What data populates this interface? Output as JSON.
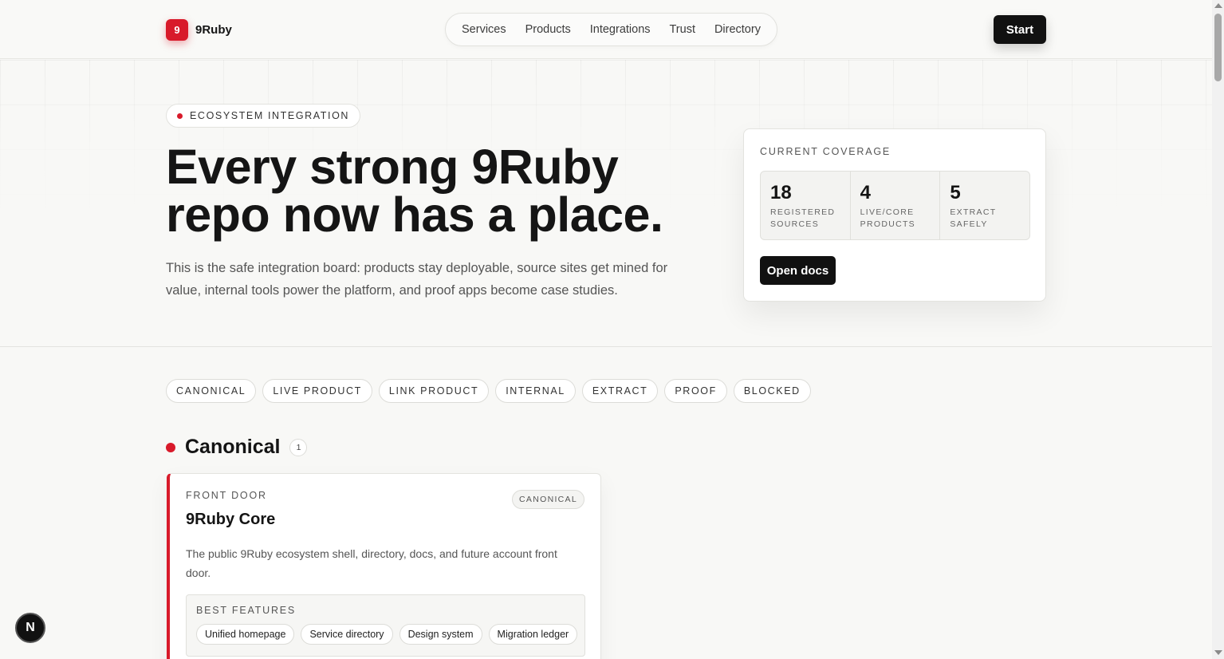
{
  "header": {
    "brand_mark": "9",
    "brand_name": "9Ruby",
    "nav": [
      "Services",
      "Products",
      "Integrations",
      "Trust",
      "Directory"
    ],
    "start_label": "Start"
  },
  "hero": {
    "eyebrow": "ECOSYSTEM INTEGRATION",
    "headline_line1": "Every strong 9Ruby",
    "headline_line2": "repo now has a place.",
    "lede_line1": "This is the safe integration board: products stay deployable, source sites get mined for",
    "lede_line2": "value, internal tools power the platform, and proof apps become case studies."
  },
  "coverage": {
    "title": "CURRENT COVERAGE",
    "stats": [
      {
        "value": "18",
        "label_line1": "REGISTERED",
        "label_line2": "SOURCES"
      },
      {
        "value": "4",
        "label_line1": "LIVE/CORE",
        "label_line2": "PRODUCTS"
      },
      {
        "value": "5",
        "label_line1": "EXTRACT",
        "label_line2": "SAFELY"
      }
    ],
    "button_label": "Open docs"
  },
  "filters": [
    "CANONICAL",
    "LIVE PRODUCT",
    "LINK PRODUCT",
    "INTERNAL",
    "EXTRACT",
    "PROOF",
    "BLOCKED"
  ],
  "section": {
    "title": "Canonical",
    "count": "1"
  },
  "card": {
    "kicker": "FRONT DOOR",
    "badge": "CANONICAL",
    "title": "9Ruby Core",
    "desc_line1": "The public 9Ruby ecosystem shell, directory, docs, and future account front",
    "desc_line2": "door.",
    "features_title": "BEST FEATURES",
    "features": [
      "Unified homepage",
      "Service directory",
      "Design system",
      "Migration ledger"
    ]
  },
  "floating_button_label": "N",
  "colors": {
    "accent": "#d81a2a",
    "dark": "#111111",
    "background": "#f8f8f6"
  }
}
